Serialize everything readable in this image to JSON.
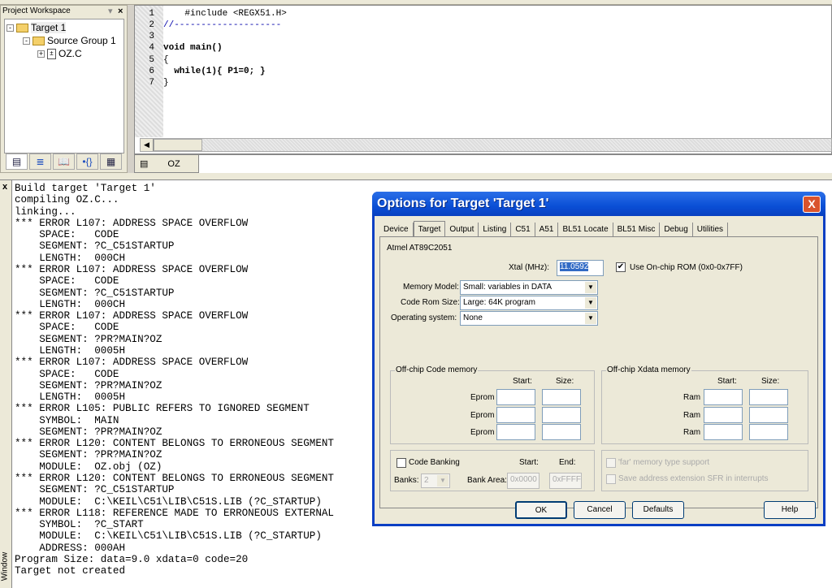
{
  "workspace": {
    "title": "Project Workspace",
    "tree": [
      {
        "label": "Target 1",
        "expander": "-"
      },
      {
        "label": "Source Group 1",
        "expander": "-"
      },
      {
        "label": "OZ.C",
        "expander": "+"
      }
    ],
    "tabs": [
      "files-icon",
      "regs-icon",
      "books-icon",
      "functions-icon",
      "templates-icon"
    ]
  },
  "editor": {
    "lines": [
      {
        "n": "1",
        "text": "    #include <REGX51.H>"
      },
      {
        "n": "2",
        "text": "//--------------------"
      },
      {
        "n": "3",
        "text": ""
      },
      {
        "n": "4",
        "text": "void main()"
      },
      {
        "n": "5",
        "text": "{"
      },
      {
        "n": "6",
        "text": "  while(1){ P1=0; }"
      },
      {
        "n": "7",
        "text": "}"
      }
    ],
    "tab": "OZ"
  },
  "output": {
    "close": "x",
    "window_label": "Window",
    "lines": [
      "Build target 'Target 1'",
      "compiling OZ.C...",
      "linking...",
      "*** ERROR L107: ADDRESS SPACE OVERFLOW",
      "    SPACE:   CODE",
      "    SEGMENT: ?C_C51STARTUP",
      "    LENGTH:  000CH",
      "*** ERROR L107: ADDRESS SPACE OVERFLOW",
      "    SPACE:   CODE",
      "    SEGMENT: ?C_C51STARTUP",
      "    LENGTH:  000CH",
      "*** ERROR L107: ADDRESS SPACE OVERFLOW",
      "    SPACE:   CODE",
      "    SEGMENT: ?PR?MAIN?OZ",
      "    LENGTH:  0005H",
      "*** ERROR L107: ADDRESS SPACE OVERFLOW",
      "    SPACE:   CODE",
      "    SEGMENT: ?PR?MAIN?OZ",
      "    LENGTH:  0005H",
      "*** ERROR L105: PUBLIC REFERS TO IGNORED SEGMENT",
      "    SYMBOL:  MAIN",
      "    SEGMENT: ?PR?MAIN?OZ",
      "*** ERROR L120: CONTENT BELONGS TO ERRONEOUS SEGMENT",
      "    SEGMENT: ?PR?MAIN?OZ",
      "    MODULE:  OZ.obj (OZ)",
      "*** ERROR L120: CONTENT BELONGS TO ERRONEOUS SEGMENT",
      "    SEGMENT: ?C_C51STARTUP",
      "    MODULE:  C:\\KEIL\\C51\\LIB\\C51S.LIB (?C_STARTUP)",
      "*** ERROR L118: REFERENCE MADE TO ERRONEOUS EXTERNAL",
      "    SYMBOL:  ?C_START",
      "    MODULE:  C:\\KEIL\\C51\\LIB\\C51S.LIB (?C_STARTUP)",
      "    ADDRESS: 000AH",
      "Program Size: data=9.0 xdata=0 code=20",
      "Target not created"
    ]
  },
  "dialog": {
    "title": "Options for Target 'Target 1'",
    "close": "X",
    "tabs": [
      "Device",
      "Target",
      "Output",
      "Listing",
      "C51",
      "A51",
      "BL51 Locate",
      "BL51 Misc",
      "Debug",
      "Utilities"
    ],
    "active_tab": "Target",
    "device": "Atmel AT89C2051",
    "xtal_label": "Xtal (MHz):",
    "xtal_value": "11.0592",
    "onchip_rom_label": "Use On-chip ROM (0x0-0x7FF)",
    "onchip_rom_checked": true,
    "memory_model_label": "Memory Model:",
    "memory_model": "Small: variables in DATA",
    "code_rom_label": "Code Rom Size:",
    "code_rom": "Large: 64K program",
    "os_label": "Operating system:",
    "os": "None",
    "code_mem": {
      "title": "Off-chip Code memory",
      "start": "Start:",
      "size": "Size:",
      "rows": [
        "Eprom",
        "Eprom",
        "Eprom"
      ]
    },
    "xdata_mem": {
      "title": "Off-chip Xdata memory",
      "start": "Start:",
      "size": "Size:",
      "rows": [
        "Ram",
        "Ram",
        "Ram"
      ]
    },
    "banking": {
      "label": "Code Banking",
      "checked": false,
      "start": "Start:",
      "end": "End:",
      "banks_label": "Banks:",
      "banks": "2",
      "area_label": "Bank Area:",
      "area_start": "0x0000",
      "area_end": "0xFFFF"
    },
    "far_label": "'far' memory type support",
    "sfr_label": "Save address extension SFR in interrupts",
    "buttons": {
      "ok": "OK",
      "cancel": "Cancel",
      "defaults": "Defaults",
      "help": "Help"
    },
    "colors": {
      "title_bar": "#0a4fd6",
      "close": "#d9532d"
    }
  }
}
